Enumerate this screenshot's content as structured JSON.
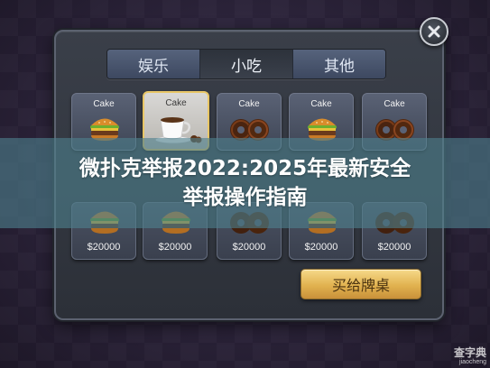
{
  "tabs": [
    {
      "label": "娱乐",
      "active": false
    },
    {
      "label": "小吃",
      "active": true
    },
    {
      "label": "其他",
      "active": false
    }
  ],
  "top_row": [
    {
      "title": "Cake",
      "icon": "burger-icon"
    },
    {
      "title": "Cake",
      "icon": "coffee-cup-icon",
      "selected": true
    },
    {
      "title": "Cake",
      "icon": "donut-icon"
    },
    {
      "title": "Cake",
      "icon": "burger-icon"
    },
    {
      "title": "Cake",
      "icon": "donut-icon"
    }
  ],
  "bottom_row": [
    {
      "price": "$20000",
      "icon": "burger-icon"
    },
    {
      "price": "$20000",
      "icon": "burger-icon"
    },
    {
      "price": "$20000",
      "icon": "donut-icon"
    },
    {
      "price": "$20000",
      "icon": "burger-icon"
    },
    {
      "price": "$20000",
      "icon": "donut-icon"
    }
  ],
  "buy_button": "买给牌桌",
  "banner": {
    "line1": "微扑克举报2022:2025年最新安全",
    "line2": "举报操作指南"
  },
  "watermark": {
    "top": "查字典",
    "bottom": "jiaocheng"
  },
  "colors": {
    "selected_border": "#e8c666",
    "button_gold": "#e1b24f",
    "banner_overlay": "#4e808c"
  }
}
